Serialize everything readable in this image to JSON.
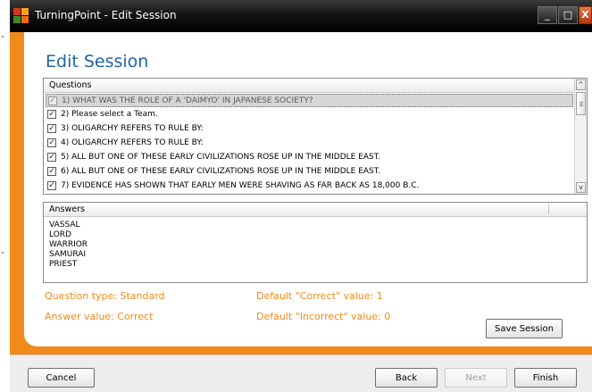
{
  "window": {
    "title": "TurningPoint - Edit Session",
    "minimize_label": "_",
    "maximize_label": "□",
    "close_label": "X"
  },
  "page": {
    "heading": "Edit Session"
  },
  "questions": {
    "header": "Questions",
    "items": [
      {
        "label": "1) WHAT WAS THE ROLE OF A 'DAIMYO' IN JAPANESE SOCIETY?",
        "checked": true
      },
      {
        "label": "2) Please select a Team.",
        "checked": true
      },
      {
        "label": "3) OLIGARCHY REFERS TO RULE BY:",
        "checked": true
      },
      {
        "label": "4) OLIGARCHY REFERS TO RULE BY:",
        "checked": true
      },
      {
        "label": "5) ALL BUT ONE OF THESE EARLY CIVILIZATIONS ROSE UP IN THE MIDDLE EAST.",
        "checked": true
      },
      {
        "label": "6) ALL BUT ONE OF THESE EARLY CIVILIZATIONS ROSE UP IN THE MIDDLE EAST.",
        "checked": true
      },
      {
        "label": "7) EVIDENCE HAS SHOWN THAT EARLY MEN WERE SHAVING AS FAR BACK AS 18,000 B.C.",
        "checked": true
      }
    ],
    "check_glyph": "✓",
    "scroll_up": "^",
    "scroll_down": "v"
  },
  "answers": {
    "header": "Answers",
    "items": [
      "VASSAL",
      "LORD",
      "WARRIOR",
      "SAMURAI",
      "PRIEST"
    ]
  },
  "info": {
    "question_type": "Question type: Standard",
    "answer_value": "Answer value: Correct",
    "default_correct": "Default \"Correct\" value: 1",
    "default_incorrect": "Default \"Incorrect\" value: 0"
  },
  "buttons": {
    "save_session": "Save Session",
    "cancel": "Cancel",
    "back": "Back",
    "next": "Next",
    "finish": "Finish"
  },
  "colors": {
    "frame_orange": "#f08a1c",
    "heading_blue": "#1f63a8",
    "info_orange": "#f08a1c",
    "close_red": "#c4431a"
  }
}
